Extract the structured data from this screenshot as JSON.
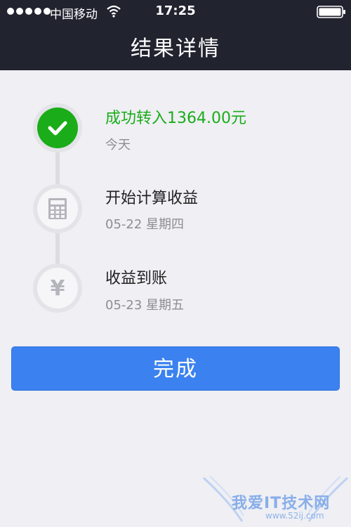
{
  "status_bar": {
    "carrier": "中国移动",
    "time": "17:25"
  },
  "header": {
    "title": "结果详情"
  },
  "steps": [
    {
      "title": "成功转入1364.00元",
      "subtitle": "今天",
      "icon": "check-icon",
      "state": "completed"
    },
    {
      "title": "开始计算收益",
      "subtitle": "05-22 星期四",
      "icon": "calculator-icon",
      "state": "pending"
    },
    {
      "title": "收益到账",
      "subtitle": "05-23 星期五",
      "icon": "yen-icon",
      "state": "pending"
    }
  ],
  "done_button": {
    "label": "完成"
  },
  "watermark": {
    "text": "我爱IT技术网",
    "url": "www.52ij.com"
  },
  "colors": {
    "header_bg": "#21232f",
    "success_green": "#1aad19",
    "button_blue": "#3b82f0",
    "page_bg": "#efeff4"
  }
}
